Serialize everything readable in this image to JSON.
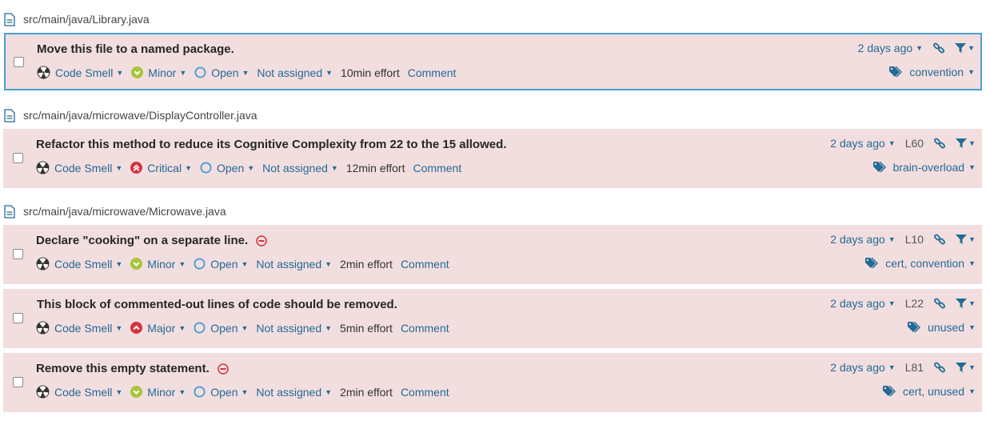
{
  "files": [
    {
      "path": "src/main/java/Library.java"
    },
    {
      "path": "src/main/java/microwave/DisplayController.java"
    },
    {
      "path": "src/main/java/microwave/Microwave.java"
    }
  ],
  "issues": [
    {
      "message": "Move this file to a named package.",
      "type": "Code Smell",
      "severity": "Minor",
      "status": "Open",
      "assignee": "Not assigned",
      "effort": "10min effort",
      "comment": "Comment",
      "when": "2 days ago",
      "line": "",
      "tags": "convention"
    },
    {
      "message": "Refactor this method to reduce its Cognitive Complexity from 22 to the 15 allowed.",
      "type": "Code Smell",
      "severity": "Critical",
      "status": "Open",
      "assignee": "Not assigned",
      "effort": "12min effort",
      "comment": "Comment",
      "when": "2 days ago",
      "line": "L60",
      "tags": "brain-overload"
    },
    {
      "message": "Declare \"cooking\" on a separate line.",
      "type": "Code Smell",
      "severity": "Minor",
      "status": "Open",
      "assignee": "Not assigned",
      "effort": "2min effort",
      "comment": "Comment",
      "when": "2 days ago",
      "line": "L10",
      "tags": "cert, convention"
    },
    {
      "message": "This block of commented-out lines of code should be removed.",
      "type": "Code Smell",
      "severity": "Major",
      "status": "Open",
      "assignee": "Not assigned",
      "effort": "5min effort",
      "comment": "Comment",
      "when": "2 days ago",
      "line": "L22",
      "tags": "unused"
    },
    {
      "message": "Remove this empty statement.",
      "type": "Code Smell",
      "severity": "Minor",
      "status": "Open",
      "assignee": "Not assigned",
      "effort": "2min effort",
      "comment": "Comment",
      "when": "2 days ago",
      "line": "L81",
      "tags": "cert, unused"
    }
  ],
  "colors": {
    "issue_bg": "#f2dede",
    "link": "#236a97",
    "selected_border": "#4b9fd5",
    "minor": "#a4c639",
    "critical": "#d4333f",
    "major": "#d4333f",
    "no_entry": "#d4333f"
  },
  "icons": {
    "file": "file-icon",
    "code_smell": "radiation-icon",
    "minor": "chevron-down-circle-icon",
    "critical": "double-chevron-up-circle-icon",
    "major": "chevron-up-circle-icon",
    "open": "open-circle-icon",
    "link": "link-icon",
    "filter": "filter-icon",
    "tag": "tag-icon",
    "no_entry": "no-entry-icon"
  }
}
